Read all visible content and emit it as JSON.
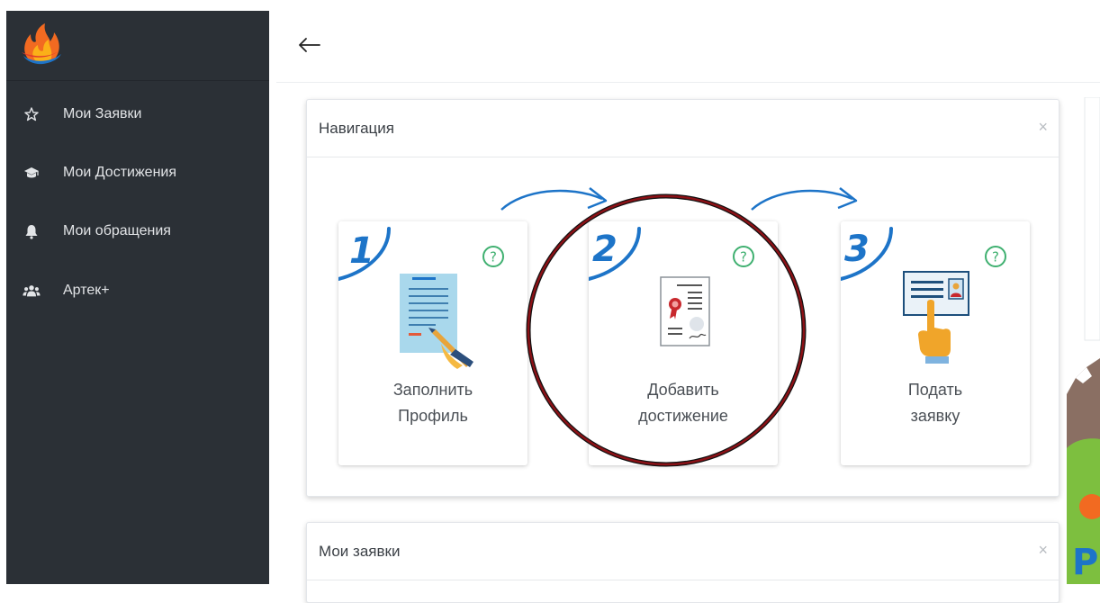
{
  "sidebar": {
    "logo": "flame-logo",
    "items": [
      {
        "icon": "star-icon",
        "label": "Мои Заявки"
      },
      {
        "icon": "graduation-cap-icon",
        "label": "Мои Достижения"
      },
      {
        "icon": "bell-icon",
        "label": "Мои обращения"
      },
      {
        "icon": "users-icon",
        "label": "Артек+"
      }
    ]
  },
  "header": {
    "back_icon": "arrow-left-icon"
  },
  "navigation_panel": {
    "title": "Навигация",
    "close_label": "×",
    "cards": [
      {
        "number": "1",
        "label": "Заполнить\nПрофиль",
        "icon": "profile-form-icon",
        "help_label": "?"
      },
      {
        "number": "2",
        "label": "Добавить\nдостижение",
        "icon": "certificate-icon",
        "help_label": "?"
      },
      {
        "number": "3",
        "label": "Подать\nзаявку",
        "icon": "application-click-icon",
        "help_label": "?"
      }
    ]
  },
  "applications_panel": {
    "title": "Мои заявки",
    "close_label": "×"
  },
  "colors": {
    "sidebar_bg": "#2b3036",
    "accent_blue": "#1d74c8",
    "help_green": "#3fb070",
    "highlight_circle": "#8b1116"
  }
}
